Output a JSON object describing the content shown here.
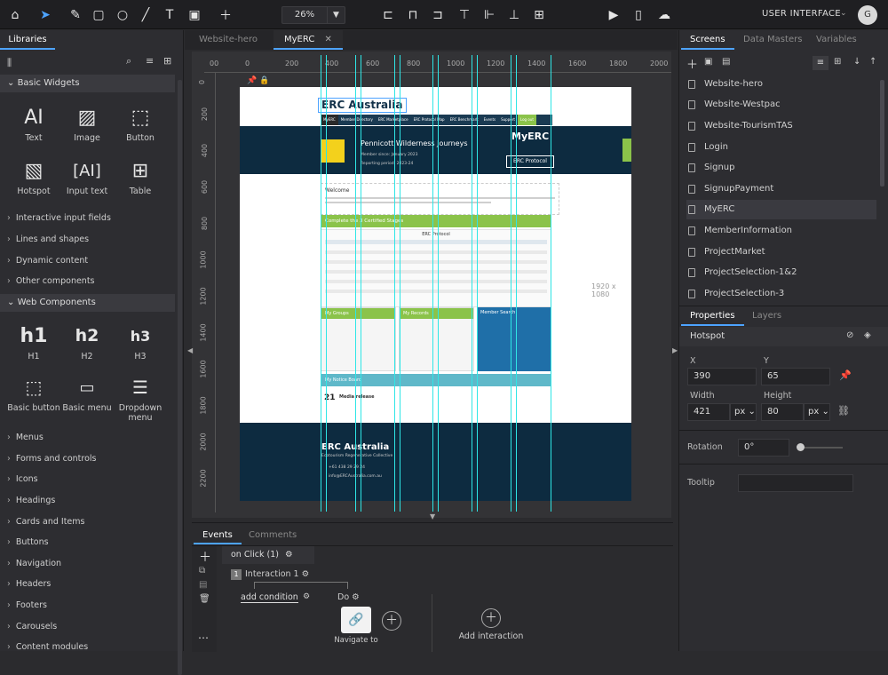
{
  "topbar": {
    "zoom": "26%",
    "workspace_label": "USER INTERFACE",
    "avatar_initial": "G"
  },
  "left_panel": {
    "tab": "Libraries",
    "basic_widgets_header": "Basic Widgets",
    "basic_widgets": [
      "Text",
      "Image",
      "Button",
      "Hotspot",
      "Input text",
      "Table"
    ],
    "categories_1": [
      "Interactive input fields",
      "Lines and shapes",
      "Dynamic content",
      "Other components"
    ],
    "web_components_header": "Web Components",
    "web_components": [
      "H1",
      "H2",
      "H3",
      "Basic button",
      "Basic menu",
      "Dropdown menu"
    ],
    "web_glyphs": [
      "h1",
      "h2",
      "h3"
    ],
    "categories_2": [
      "Menus",
      "Forms and controls",
      "Icons",
      "Headings",
      "Cards and Items",
      "Buttons",
      "Navigation",
      "Headers",
      "Footers",
      "Carousels",
      "Content modules"
    ]
  },
  "canvas": {
    "tabs": [
      "Website-hero",
      "MyERC"
    ],
    "active_tab": "MyERC",
    "ruler_h": [
      "00",
      "0",
      "200",
      "400",
      "600",
      "800",
      "1000",
      "1200",
      "1400",
      "1600",
      "1800",
      "2000"
    ],
    "ruler_v": [
      "0",
      "200",
      "400",
      "600",
      "800",
      "1000",
      "1200",
      "1400",
      "1600",
      "1800",
      "2000",
      "2200"
    ],
    "size_label": "1920 x 1080"
  },
  "mockup": {
    "brand": "ERC Australia",
    "nav": [
      "MyERC",
      "Member Directory",
      "ERC Marketplace",
      "ERC Protocol Map",
      "ERC Benchmark",
      "Events",
      "Support",
      "Log out"
    ],
    "company": "Pennicott Wilderness Journeys",
    "member_since": "Member since: January 2023",
    "reporting": "Reporting period: 2023-24",
    "myerc": "MyERC",
    "protocol": "ERC Protocol",
    "welcome": "Welcome",
    "stages_title": "Complete the 3 Certified Stages",
    "erc_protocol_table": "ERC Protocol",
    "groups": "My Groups",
    "records": "My Records",
    "member_search": "Member Search",
    "board": "My Notice Board",
    "day": "21",
    "media": "Media release",
    "footer_brand": "ERC Australia",
    "footer_sub": "Ecotourism Regenerative Collective",
    "phone": "+61 438 29 29 24",
    "email": "info@ERCAustralia.com.au"
  },
  "events": {
    "tabs": [
      "Events",
      "Comments"
    ],
    "trigger": "on Click (1)",
    "interaction": "Interaction 1",
    "interaction_num": "1",
    "add_condition": "add condition",
    "do": "Do",
    "navigate": "Navigate to",
    "add_interaction": "Add interaction"
  },
  "right_panel": {
    "tabs": [
      "Screens",
      "Data Masters",
      "Variables"
    ],
    "screens": [
      "Website-hero",
      "Website-Westpac",
      "Website-TourismTAS",
      "Login",
      "Signup",
      "SignupPayment",
      "MyERC",
      "MemberInformation",
      "ProjectMarket",
      "ProjectSelection-1&2",
      "ProjectSelection-3"
    ],
    "selected_screen": "MyERC",
    "prop_tabs": [
      "Properties",
      "Layers"
    ],
    "element": "Hotspot",
    "x_label": "X",
    "x": "390",
    "y_label": "Y",
    "y": "65",
    "width_label": "Width",
    "width": "421",
    "height_label": "Height",
    "height": "80",
    "unit": "px",
    "rotation_label": "Rotation",
    "rotation": "0°",
    "tooltip_label": "Tooltip"
  }
}
